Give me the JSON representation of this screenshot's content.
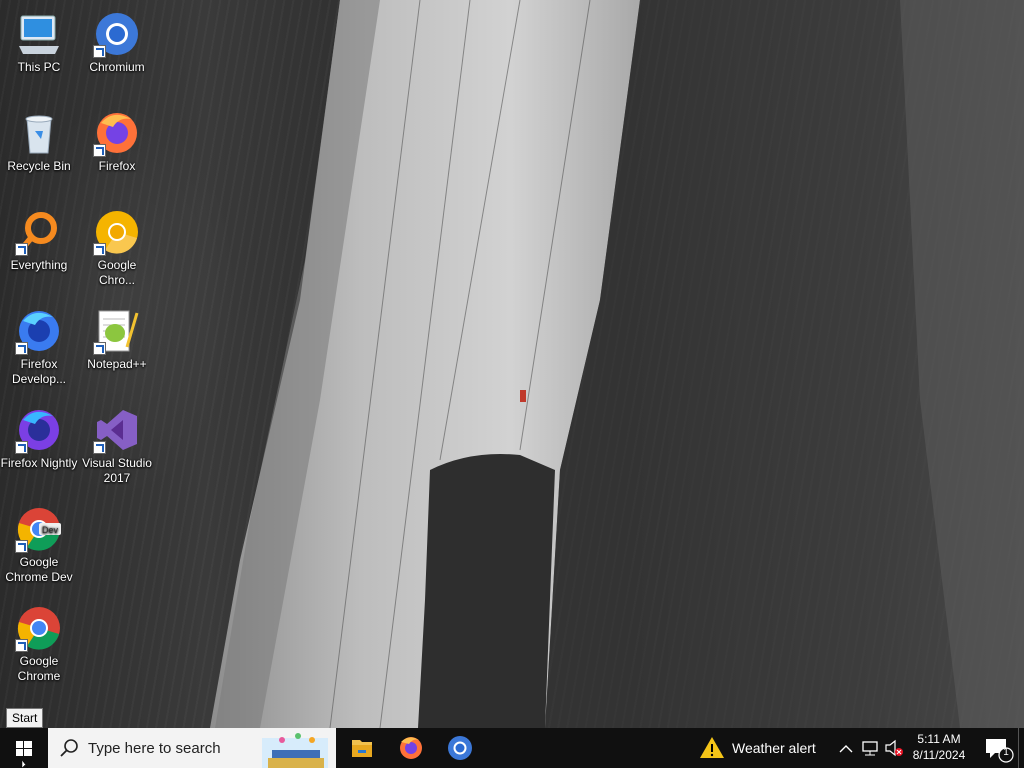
{
  "desktop_icons": [
    {
      "label": "This PC",
      "icon": "this-pc-icon"
    },
    {
      "label": "Chromium",
      "icon": "chromium-icon"
    },
    {
      "label": "Recycle Bin",
      "icon": "recycle-bin-icon"
    },
    {
      "label": "Firefox",
      "icon": "firefox-icon"
    },
    {
      "label": "Everything",
      "icon": "everything-search-icon"
    },
    {
      "label": "Google Chro...",
      "icon": "google-chrome-canary-icon"
    },
    {
      "label": "Firefox Develop...",
      "icon": "firefox-developer-icon"
    },
    {
      "label": "Notepad++",
      "icon": "notepad-plus-plus-icon"
    },
    {
      "label": "Firefox Nightly",
      "icon": "firefox-nightly-icon"
    },
    {
      "label": "Visual Studio 2017",
      "icon": "visual-studio-icon"
    },
    {
      "label": "Google Chrome Dev",
      "icon": "chrome-dev-icon"
    },
    {
      "label": "Google Chrome",
      "icon": "google-chrome-icon"
    }
  ],
  "tooltip": {
    "start": "Start"
  },
  "taskbar": {
    "search_placeholder": "Type here to search",
    "weather_label": "Weather alert",
    "time": "5:11 AM",
    "date": "8/11/2024",
    "notification_count": "1"
  },
  "colors": {
    "taskbar": "#101010",
    "accent": "#0078d7"
  }
}
